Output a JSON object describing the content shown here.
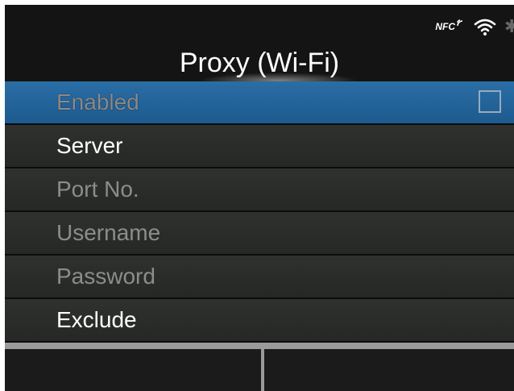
{
  "header": {
    "title": "Proxy (Wi-Fi)",
    "status_icons": [
      "nfc-icon",
      "wifi-icon",
      "bluetooth-icon"
    ],
    "nfc_label": "NFC"
  },
  "menu": {
    "items": [
      {
        "label": "Enabled",
        "selected": true,
        "enabled": false,
        "checkbox": true,
        "checked": false
      },
      {
        "label": "Server",
        "selected": false,
        "enabled": true
      },
      {
        "label": "Port No.",
        "selected": false,
        "enabled": false
      },
      {
        "label": "Username",
        "selected": false,
        "enabled": false
      },
      {
        "label": "Password",
        "selected": false,
        "enabled": false
      },
      {
        "label": "Exclude",
        "selected": false,
        "enabled": true
      }
    ]
  },
  "colors": {
    "selection": "#1d5a8e",
    "row_bg": "#2a2c2a",
    "enabled_text": "#ffffff",
    "disabled_text": "#8c8c8c"
  }
}
